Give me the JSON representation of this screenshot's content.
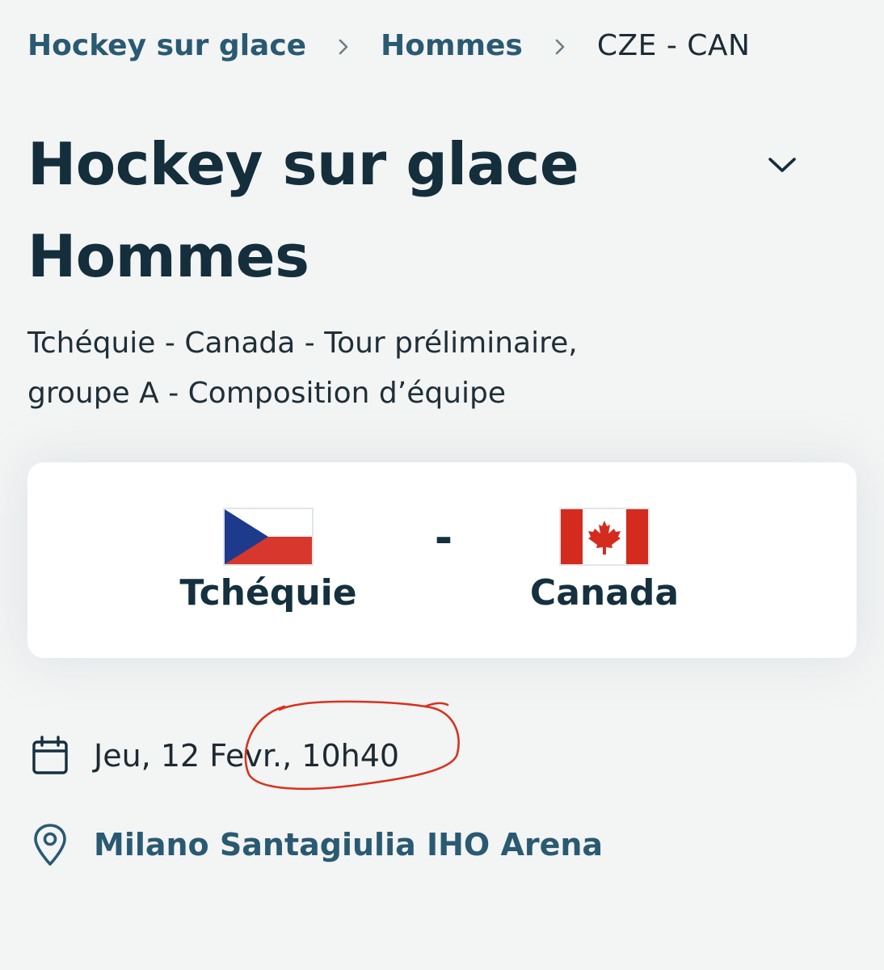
{
  "breadcrumb": {
    "items": [
      "Hockey sur glace",
      "Hommes"
    ],
    "current": "CZE - CAN"
  },
  "title": {
    "line1": "Hockey sur glace",
    "line2": "Hommes"
  },
  "subtitle": {
    "line1": "Tchéquie - Canada - Tour préliminaire,",
    "line2": "groupe A - Composition d’équipe"
  },
  "match": {
    "home": {
      "name": "Tchéquie",
      "flag": "czech-flag"
    },
    "separator": "-",
    "away": {
      "name": "Canada",
      "flag": "canada-flag"
    }
  },
  "info": {
    "date": "Jeu, 12 Fevr., 10h40",
    "venue": "Milano Santagiulia IHO Arena"
  },
  "colors": {
    "background": "#f3f4f4",
    "link": "#2a5a72",
    "heading": "#142e3c",
    "annotation": "#d8321e"
  },
  "icons": {
    "breadcrumb_separator": "chevron-right-icon",
    "expand": "chevron-down-icon",
    "date": "calendar-icon",
    "venue": "location-pin-icon"
  }
}
